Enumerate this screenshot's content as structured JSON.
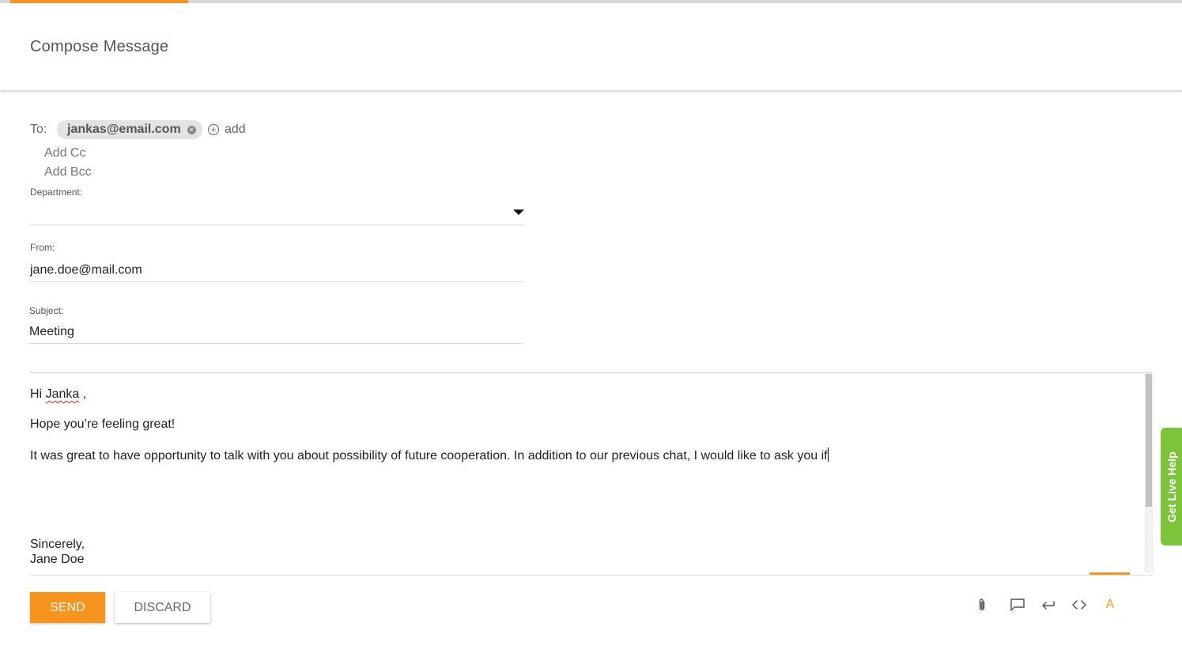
{
  "header": {
    "title": "Compose Message"
  },
  "recipients": {
    "to_label": "To:",
    "to": [
      {
        "email": "jankas@email.com"
      }
    ],
    "add_label": "add",
    "add_cc_label": "Add Cc",
    "add_bcc_label": "Add Bcc"
  },
  "department": {
    "label": "Department:",
    "value": ""
  },
  "from": {
    "label": "From:",
    "value": "jane.doe@mail.com"
  },
  "subject": {
    "label": "Subject:",
    "value": "Meeting"
  },
  "body": {
    "greeting_prefix": "Hi ",
    "greeting_name": "Janka",
    "greeting_suffix": " ,",
    "line2": "Hope you’re feeling great!",
    "line3": "It was great to have opportunity to talk with you about possibility of future cooperation. In addition to our previous chat, I would like to ask you if",
    "signoff": "Sincerely,",
    "signature": "Jane Doe"
  },
  "actions": {
    "send_label": "SEND",
    "discard_label": "DISCARD"
  },
  "toolbar": {
    "icons": [
      "paperclip-icon",
      "comment-icon",
      "reply-icon",
      "code-icon",
      "font-color-icon"
    ],
    "font_color_glyph": "A"
  },
  "live_help": {
    "label": "Get Live Help"
  },
  "colors": {
    "accent": "#f7941d",
    "live_help": "#7dc33b"
  }
}
